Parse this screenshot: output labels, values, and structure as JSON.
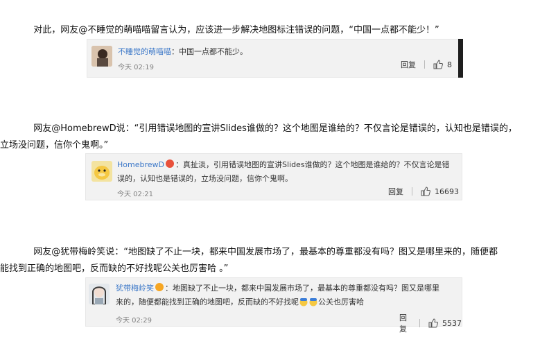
{
  "paragraphs": [
    {
      "text": "对此，网友@不睡觉的萌喵喵留言认为，应该进一步解决地图标注错误的问题，“中国一点都不能少！”"
    },
    {
      "line1": "网友@HomebrewD说：“引用错误地图的宣讲Slides谁做的？这个地图是谁给的？不仅言论是错误的，认知也是错误的，",
      "line2": "立场没问题，信你个鬼啊。”"
    },
    {
      "line1": "网友@犹带梅岭笑说：“地图缺了不止一块，都来中国发展市场了，最基本的尊重都没有吗？图又是哪里来的，随便都",
      "line2": "能找到正确的地图吧，反而缺的不好找呢公关也厉害哈 。”"
    }
  ],
  "comments": [
    {
      "username": "不睡觉的萌喵喵",
      "text": "：中国一点都不能少。",
      "time": "今天 02:19",
      "reply_label": "回复",
      "likes": "8"
    },
    {
      "username": "HomebrewD",
      "text_line1": "：真扯淡，引用错误地图的宣讲Slides谁做的？这个地图是谁给的？不仅言论是错",
      "text_line2": "误的，认知也是错误的，立场没问题，信你个鬼啊。",
      "time": "今天 02:21",
      "reply_label": "回复",
      "likes": "16693"
    },
    {
      "username": "犹带梅岭笑",
      "text_line1": "：地图缺了不止一块，都来中国发展市场了，最基本的尊重都没有吗？图又是哪里",
      "text_line2a": "来的，随便都能找到正确的地图吧，反而缺的不好找呢",
      "text_line2b": "公关也厉害哈",
      "time": "今天 02:29",
      "reply_label": "回复",
      "likes": "5537"
    }
  ],
  "icons": {
    "thumb": "thumbs-up-icon",
    "vip": "vip-badge-icon",
    "emoji": "emoji-icon"
  },
  "colors": {
    "username": "#eb7350",
    "meta": "#808080",
    "card_bg": "#f2f2f2"
  }
}
